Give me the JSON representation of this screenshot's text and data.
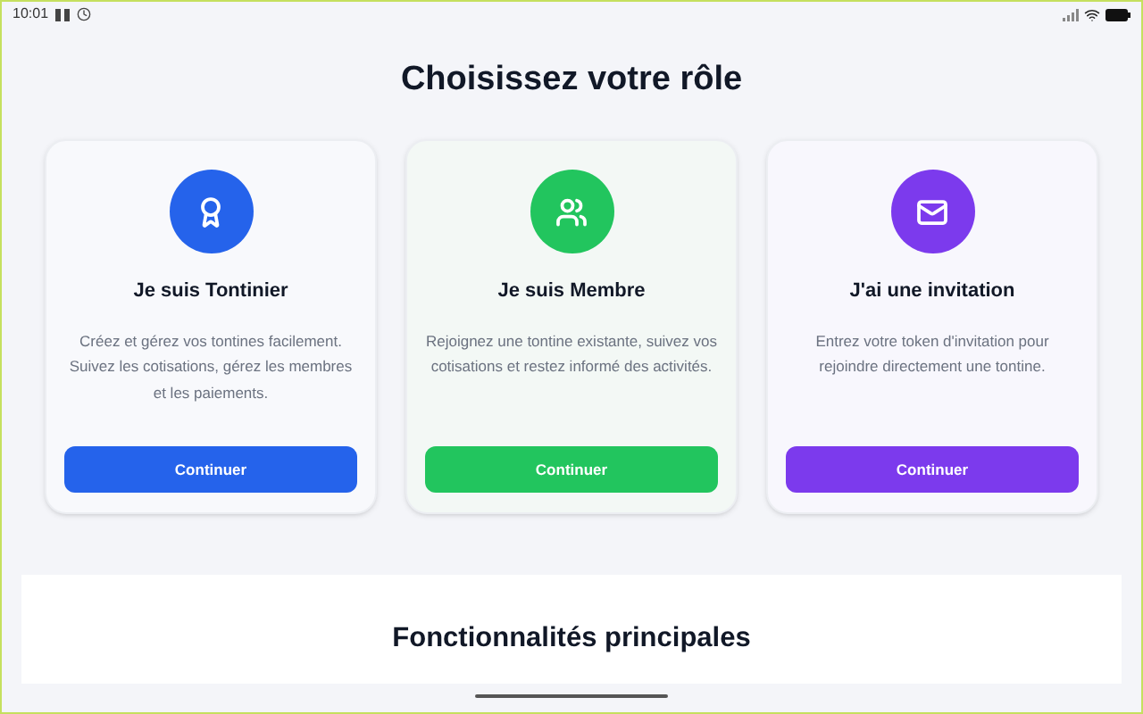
{
  "status_bar": {
    "time": "10:01"
  },
  "title": "Choisissez votre rôle",
  "roles": [
    {
      "kind": "award",
      "color": "#2563eb",
      "title": "Je suis Tontinier",
      "description": "Créez et gérez vos tontines facilement. Suivez les cotisations, gérez les membres et les paiements.",
      "button": "Continuer"
    },
    {
      "kind": "users",
      "color": "#22c55e",
      "title": "Je suis Membre",
      "description": "Rejoignez une tontine existante, suivez vos cotisations et restez informé des activités.",
      "button": "Continuer"
    },
    {
      "kind": "mail",
      "color": "#7c3aed",
      "title": "J'ai une invitation",
      "description": "Entrez votre token d'invitation pour rejoindre directement une tontine.",
      "button": "Continuer"
    }
  ],
  "features": {
    "title": "Fonctionnalités principales"
  }
}
